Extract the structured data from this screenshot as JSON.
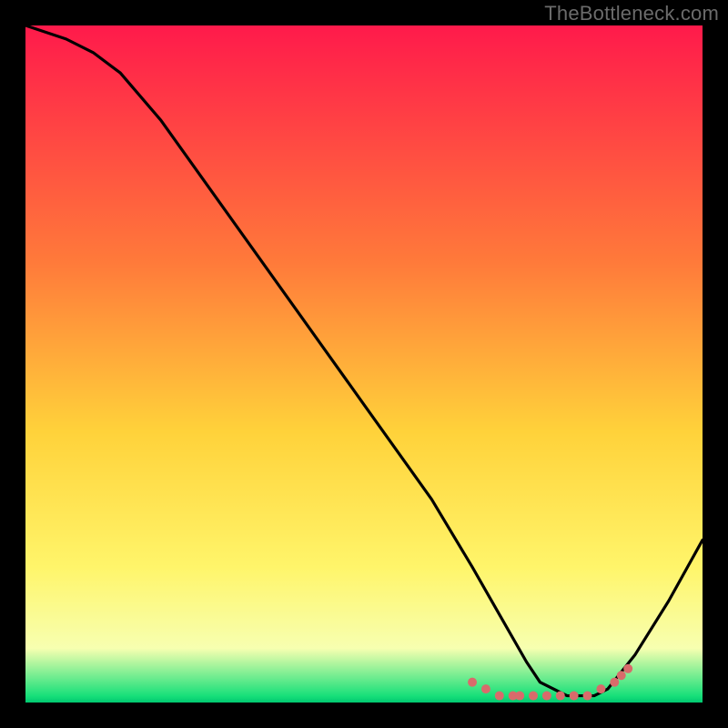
{
  "watermark": "TheBottleneck.com",
  "colors": {
    "gradient_top": "#ff1a4b",
    "gradient_upper_mid": "#ff7a3a",
    "gradient_mid": "#ffd23a",
    "gradient_lower_mid": "#fff56a",
    "gradient_near_bottom": "#f7ffb0",
    "gradient_bottom": "#00c870",
    "curve": "#000000",
    "marker": "#d86b6b"
  },
  "chart_data": {
    "type": "line",
    "title": "",
    "xlabel": "",
    "ylabel": "",
    "xlim": [
      0,
      100
    ],
    "ylim": [
      0,
      100
    ],
    "series": [
      {
        "name": "bottleneck-curve",
        "x": [
          0,
          6,
          10,
          14,
          20,
          30,
          40,
          50,
          60,
          66,
          70,
          74,
          76,
          80,
          84,
          86,
          90,
          95,
          100
        ],
        "values": [
          100,
          98,
          96,
          93,
          86,
          72,
          58,
          44,
          30,
          20,
          13,
          6,
          3,
          1,
          1,
          2,
          7,
          15,
          24
        ]
      }
    ],
    "markers": {
      "name": "highlight-points",
      "x": [
        66,
        68,
        70,
        72,
        73,
        75,
        77,
        79,
        81,
        83,
        85,
        87,
        88,
        89
      ],
      "values": [
        3,
        2,
        1,
        1,
        1,
        1,
        1,
        1,
        1,
        1,
        2,
        3,
        4,
        5
      ]
    }
  }
}
